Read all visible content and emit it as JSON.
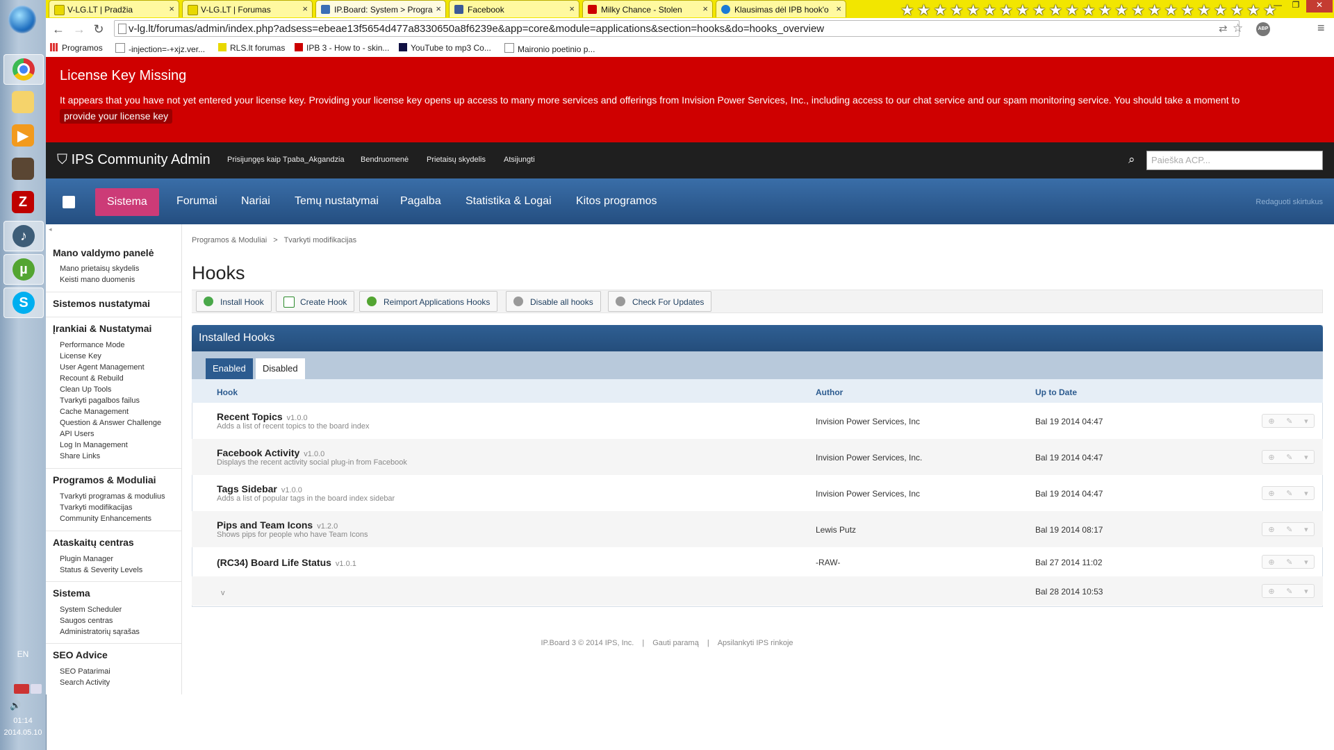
{
  "taskbar": {
    "language": "EN",
    "time": "01:14",
    "date": "2014.05.10",
    "apps": [
      "chrome",
      "explorer",
      "media-player",
      "avatar-app",
      "filezilla",
      "audio-app",
      "utorrent",
      "skype"
    ]
  },
  "browser": {
    "tabs": [
      {
        "title": "V-LG.LT | Pradžia",
        "color": "#f2e600"
      },
      {
        "title": "V-LG.LT | Forumas",
        "color": "#f2e600"
      },
      {
        "title": "IP.Board: System > Progra",
        "color": "#3b6fb6"
      },
      {
        "title": "Facebook",
        "color": "#3b5998"
      },
      {
        "title": "Milky Chance - Stolen",
        "color": "#cc0000"
      },
      {
        "title": "Klausimas dėl IPB hook'o",
        "color": "#1a7bd6"
      }
    ],
    "close_glyph": "×",
    "url": "v-lg.lt/forumas/admin/index.php?adsess=ebeae13f5654d477a8330650a8f6239e&app=core&module=applications&section=hooks&do=hooks_overview",
    "extension_badge": "ABP",
    "bookmarks": [
      "Programos",
      "-injection=-+xjz.ver...",
      "RLS.lt forumas",
      "IPB 3 - How to - skin...",
      "YouTube to mp3 Co...",
      "Maironio poetinio p..."
    ]
  },
  "license_banner": {
    "title": "License Key Missing",
    "message": "It appears that you have not yet entered your license key. Providing your license key opens up access to many more services and offerings from Invision Power Services, Inc., including access to our chat service and our spam monitoring service. You should take a moment to",
    "link": "provide your license key"
  },
  "admin_header": {
    "brand": "IPS Community Admin",
    "links": [
      "Prisijungęs kaip Tpaba_Akgandzia",
      "Bendruomenė",
      "Prietaisų skydelis",
      "Atsijungti"
    ],
    "search_placeholder": "Paieška ACP..."
  },
  "main_nav": {
    "items": [
      "Sistema",
      "Forumai",
      "Nariai",
      "Temų nustatymai",
      "Pagalba",
      "Statistika & Logai",
      "Kitos programos"
    ],
    "active": "Sistema",
    "edit_tabs": "Redaguoti skirtukus",
    "accent": "#cc3b77"
  },
  "sidebar": {
    "sections": [
      {
        "title": "Mano valdymo panelė",
        "items": [
          "Mano prietaisų skydelis",
          "Keisti mano duomenis"
        ]
      },
      {
        "title": "Sistemos nustatymai",
        "items": []
      },
      {
        "title": "Įrankiai & Nustatymai",
        "items": [
          "Performance Mode",
          "License Key",
          "User Agent Management",
          "Recount & Rebuild",
          "Clean Up Tools",
          "Tvarkyti pagalbos failus",
          "Cache Management",
          "Question & Answer Challenge",
          "API Users",
          "Log In Management",
          "Share Links"
        ]
      },
      {
        "title": "Programos & Moduliai",
        "items": [
          "Tvarkyti programas & modulius",
          "Tvarkyti modifikacijas",
          "Community Enhancements"
        ]
      },
      {
        "title": "Ataskaitų centras",
        "items": [
          "Plugin Manager",
          "Status & Severity Levels"
        ]
      },
      {
        "title": "Sistema",
        "items": [
          "System Scheduler",
          "Saugos centras",
          "Administratorių sąrašas"
        ]
      },
      {
        "title": "SEO Advice",
        "items": [
          "SEO Patarimai",
          "Search Activity"
        ]
      }
    ]
  },
  "content": {
    "breadcrumb": [
      "Programos & Moduliai",
      ">",
      "Tvarkyti modifikacijas"
    ],
    "title": "Hooks",
    "actions": [
      "Install Hook",
      "Create Hook",
      "Reimport Applications Hooks",
      "Disable all hooks",
      "Check For Updates"
    ],
    "panel_title": "Installed Hooks",
    "subtabs": [
      "Enabled",
      "Disabled"
    ],
    "active_subtab": "Disabled",
    "columns": [
      "Hook",
      "Author",
      "Up to Date"
    ],
    "hooks": [
      {
        "name": "Recent Topics",
        "version": "v1.0.0",
        "description": "Adds a list of recent topics to the board index",
        "author": "Invision Power Services, Inc",
        "date": "Bal 19 2014 04:47"
      },
      {
        "name": "Facebook Activity",
        "version": "v1.0.0",
        "description": "Displays the recent activity social plug-in from Facebook",
        "author": "Invision Power Services, Inc.",
        "date": "Bal 19 2014 04:47"
      },
      {
        "name": "Tags Sidebar",
        "version": "v1.0.0",
        "description": "Adds a list of popular tags in the board index sidebar",
        "author": "Invision Power Services, Inc",
        "date": "Bal 19 2014 04:47"
      },
      {
        "name": "Pips and Team Icons",
        "version": "v1.2.0",
        "description": "Shows pips for people who have Team Icons",
        "author": "Lewis Putz",
        "date": "Bal 19 2014 08:17"
      },
      {
        "name": "(RC34) Board Life Status",
        "version": "v1.0.1",
        "description": "",
        "author": "-RAW-",
        "date": "Bal 27 2014 11:02"
      },
      {
        "name": "",
        "version": "v",
        "description": "",
        "author": "",
        "date": "Bal 28 2014 10:53"
      }
    ]
  },
  "footer": [
    "IP.Board 3 © 2014 IPS, Inc.",
    "|",
    "Gauti paramą",
    "|",
    "Apsilankyti IPS rinkoje"
  ]
}
